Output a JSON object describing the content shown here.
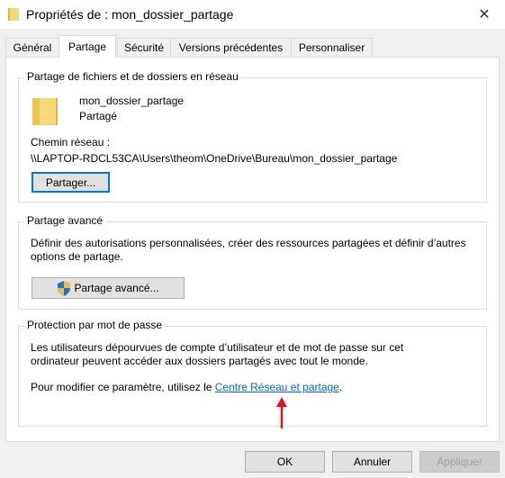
{
  "window": {
    "title": "Propriétés de : mon_dossier_partage",
    "close_glyph": "✕"
  },
  "tabs": [
    {
      "label": "Général"
    },
    {
      "label": "Partage"
    },
    {
      "label": "Sécurité"
    },
    {
      "label": "Versions précédentes"
    },
    {
      "label": "Personnaliser"
    }
  ],
  "sharing": {
    "group_title": "Partage de fichiers et de dossiers en réseau",
    "folder_name": "mon_dossier_partage",
    "status": "Partagé",
    "path_label": "Chemin réseau :",
    "path_value": "\\\\LAPTOP-RDCL53CA\\Users\\theom\\OneDrive\\Bureau\\mon_dossier_partage",
    "share_button": "Partager..."
  },
  "advanced": {
    "group_title": "Partage avancé",
    "description_line1": "Définir des autorisations personnalisées, créer des ressources partagées et définir d’autres",
    "description_line2": "options de partage.",
    "button": "Partage avancé..."
  },
  "password": {
    "group_title": "Protection par mot de passe",
    "description_line1": "Les utilisateurs dépourvues de compte d’utilisateur et de mot de passe sur cet",
    "description_line2": "ordinateur peuvent accéder aux dossiers partagés avec tout le monde.",
    "modify_prefix": "Pour modifier ce paramètre, utilisez le ",
    "link_text": "Centre Réseau et partage",
    "modify_suffix": "."
  },
  "footer": {
    "ok": "OK",
    "cancel": "Annuler",
    "apply": "Appliquer"
  },
  "colors": {
    "accent": "#0078d7",
    "link": "#0066cc",
    "annotation_arrow": "#e81123",
    "folder": "#f8d775"
  },
  "icons": {
    "title_icon": "folder-icon",
    "folder_icon": "folder-icon",
    "shield_icon": "uac-shield-icon",
    "close_icon": "close-icon",
    "annotation": "red-arrow-icon"
  }
}
